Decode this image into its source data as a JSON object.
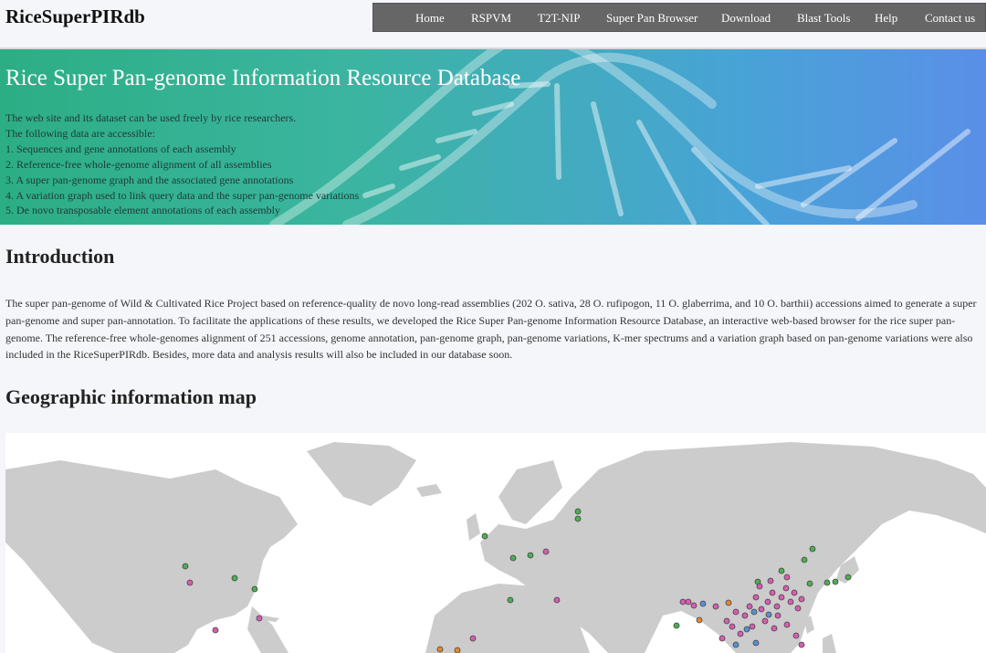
{
  "header": {
    "brand": "RiceSuperPIRdb",
    "nav": [
      "Home",
      "RSPVM",
      "T2T-NIP",
      "Super Pan Browser",
      "Download",
      "Blast Tools",
      "Help",
      "Contact us"
    ]
  },
  "banner": {
    "title": "Rice Super Pan-genome Information Resource Database",
    "lines": [
      "The web site and its dataset can be used freely by rice researchers.",
      "The following data are accessible:",
      "1. Sequences and gene annotations of each assembly",
      "2. Reference-free whole-genome alignment of all assemblies",
      "3. A super pan-genome graph and the associated gene annotations",
      "4. A variation graph used to link query data and the super pan-genome variations",
      "5. De novo transposable element annotations of each assembly"
    ]
  },
  "intro": {
    "heading": "Introduction",
    "text": "The super pan-genome of Wild & Cultivated Rice Project based on reference-quality de novo long-read assemblies (202 O. sativa, 28 O. rufipogon, 11 O. glaberrima, and 10 O. barthii) accessions aimed to generate a super pan-genome and super pan-annotation. To facilitate the applications of these results, we developed the Rice Super Pan-genome Information Resource Database, an interactive web-based browser for the rice super pan-genome. The reference-free whole-genomes alignment of 251 accessions, genome annotation, pan-genome graph, pan-genome variations, K-mer  spectrums and a variation graph based on pan-genome variations were also included in the RiceSuperPIRdb. Besides, more data and analysis results will also be included in our database soon."
  },
  "geo": {
    "heading": "Geographic information map"
  },
  "colors": {
    "land": "#cccccc",
    "ocean": "#ffffff",
    "marker_green": "#4caf50",
    "marker_pink": "#d65db1",
    "marker_blue": "#5b8fd6",
    "marker_orange": "#e08a2e"
  }
}
